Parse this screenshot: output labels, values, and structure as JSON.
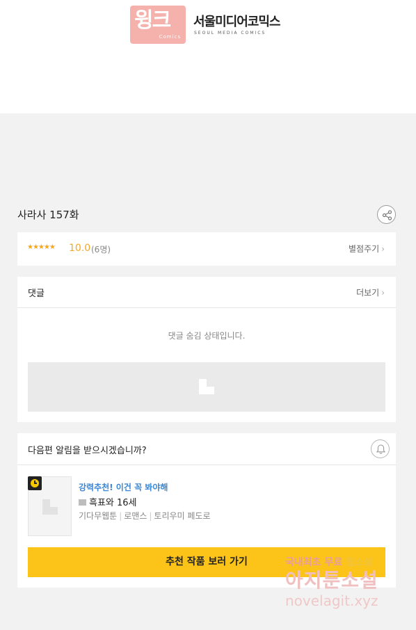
{
  "header": {
    "wink_logo": "윙크",
    "wink_sub": "Comics",
    "publisher_logo": "서울미디어코믹스",
    "publisher_sub": "SEOUL MEDIA COMICS"
  },
  "episode": {
    "title": "사라사 157화"
  },
  "rating": {
    "stars": "★★★★★",
    "score": "10.0",
    "count": "(6명)",
    "rate_label": "별점주기"
  },
  "comments": {
    "title": "댓글",
    "more_label": "더보기",
    "hidden_message": "댓글 숨김 상태입니다."
  },
  "notification": {
    "question": "다음편 알림을 받으시겠습니까?"
  },
  "recommendation": {
    "tagline": "강력추천! 이건 꼭 봐야해",
    "title": "흑표와 16세",
    "meta": [
      "기다무웹툰",
      "로맨스",
      "토리우미 페도로"
    ],
    "cta_label": "추천 작품 보러 가기"
  },
  "watermark": {
    "line1_a": "국내최초 무료 ",
    "line1_b": "웹소설",
    "line2": "아지툰소설",
    "line3": "novelagit.xyz"
  },
  "icons": [
    "share-icon",
    "bell-icon",
    "clock-icon",
    "image-placeholder-icon",
    "chevron-right-icon"
  ],
  "colors": {
    "accent": "#f5a623",
    "cta": "#fcc419",
    "link": "#3a86d4",
    "wink_pink": "#f5b2ad"
  }
}
